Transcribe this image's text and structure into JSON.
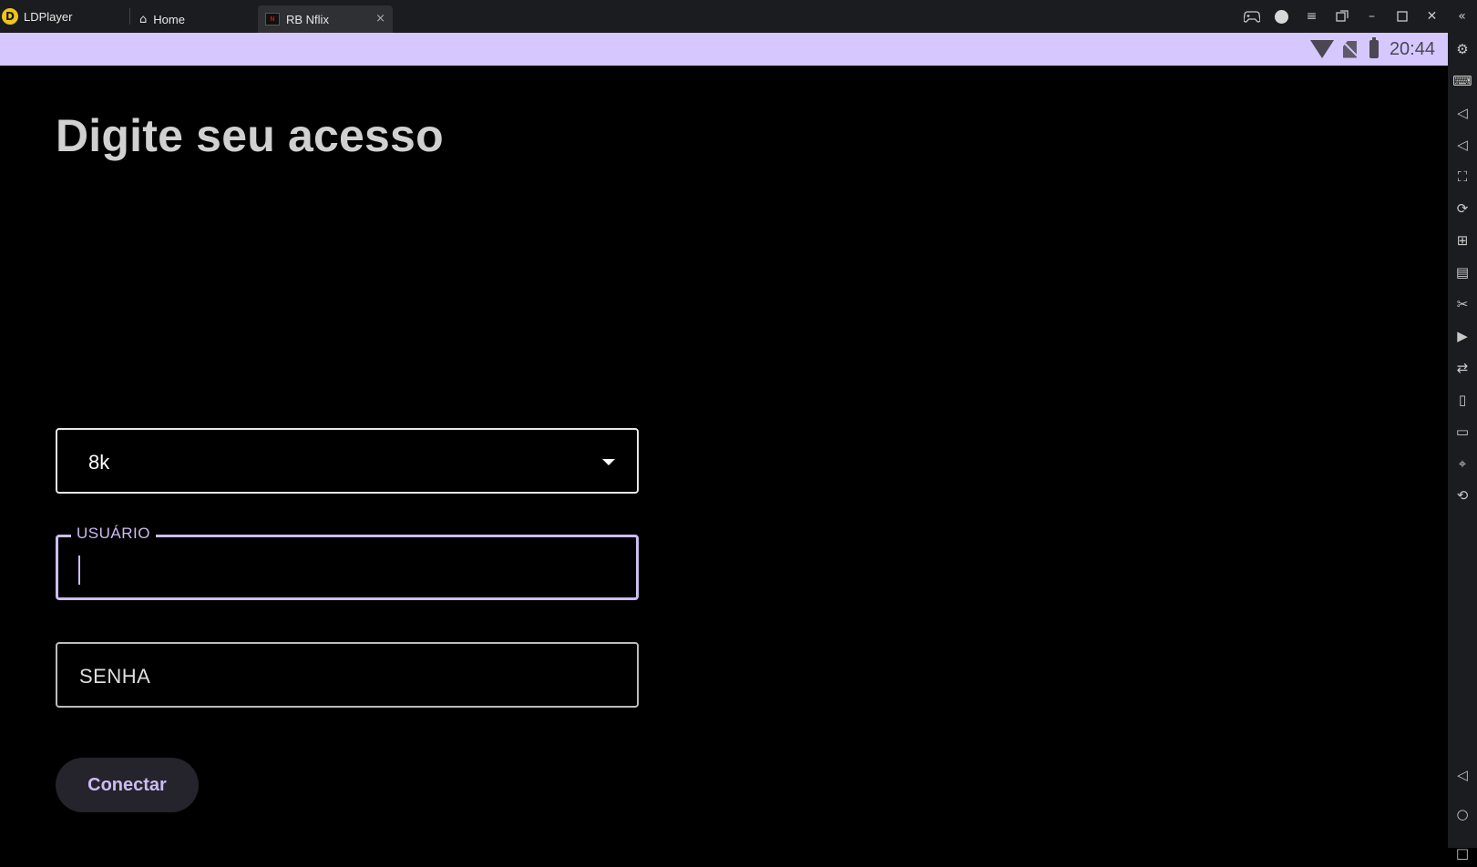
{
  "window": {
    "app_name": "LDPlayer",
    "tabs": [
      {
        "label": "Home"
      },
      {
        "label": "RB Nflix"
      }
    ]
  },
  "status_bar": {
    "time": "20:44"
  },
  "screen": {
    "title": "Digite seu acesso",
    "server_select": {
      "value": "8k"
    },
    "username": {
      "label": "USUÁRIO",
      "value": ""
    },
    "password": {
      "placeholder": "SENHA",
      "value": ""
    },
    "connect_button": "Conectar"
  },
  "colors": {
    "accent": "#cdbcf2",
    "status_bar": "#d6c8ff",
    "background": "#000000",
    "button_bg": "#25232c"
  }
}
